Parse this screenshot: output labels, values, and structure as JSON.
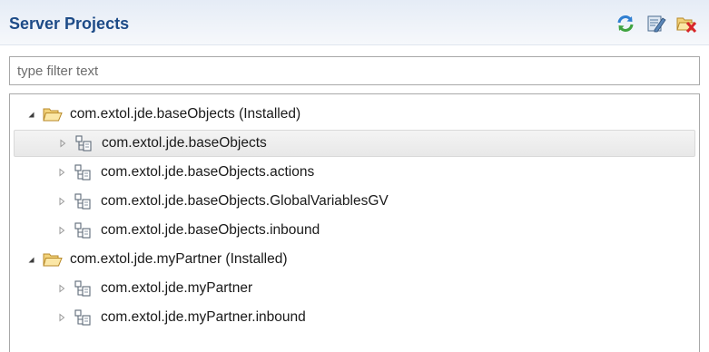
{
  "header": {
    "title": "Server Projects",
    "toolbar": [
      {
        "name": "refresh-icon"
      },
      {
        "name": "properties-icon"
      },
      {
        "name": "remove-project-icon"
      }
    ]
  },
  "filter": {
    "placeholder": "type filter text",
    "value": ""
  },
  "tree": {
    "projects": [
      {
        "label": "com.extol.jde.baseObjects (Installed)",
        "expanded": true,
        "icon": "folder-open-icon",
        "children": [
          {
            "label": "com.extol.jde.baseObjects",
            "selected": true,
            "icon": "package-icon"
          },
          {
            "label": "com.extol.jde.baseObjects.actions",
            "icon": "package-icon"
          },
          {
            "label": "com.extol.jde.baseObjects.GlobalVariablesGV",
            "icon": "package-icon"
          },
          {
            "label": "com.extol.jde.baseObjects.inbound",
            "icon": "package-icon"
          }
        ]
      },
      {
        "label": "com.extol.jde.myPartner (Installed)",
        "expanded": true,
        "icon": "folder-open-icon",
        "children": [
          {
            "label": "com.extol.jde.myPartner",
            "icon": "package-icon"
          },
          {
            "label": "com.extol.jde.myPartner.inbound",
            "icon": "package-icon"
          }
        ]
      }
    ]
  }
}
